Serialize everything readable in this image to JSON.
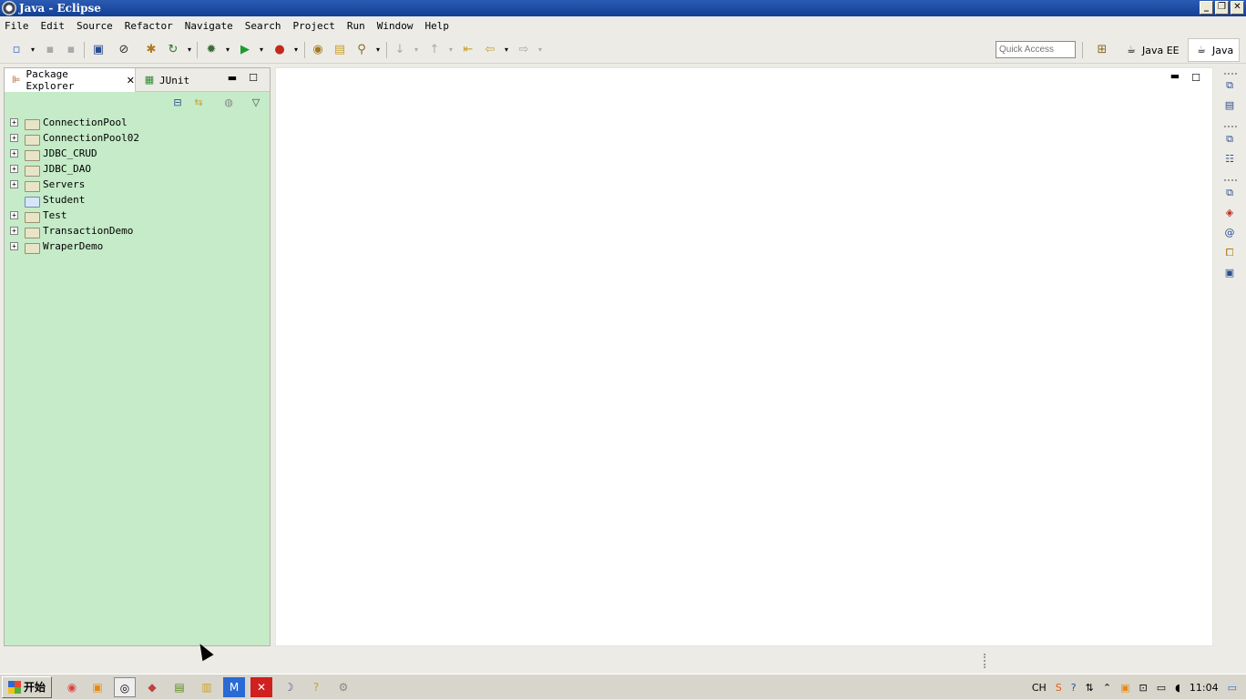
{
  "window": {
    "title": "Java - Eclipse",
    "controls": [
      "_",
      "❐",
      "✕"
    ]
  },
  "menu": [
    "File",
    "Edit",
    "Source",
    "Refactor",
    "Navigate",
    "Search",
    "Project",
    "Run",
    "Window",
    "Help"
  ],
  "quick_access": {
    "placeholder": "Quick Access"
  },
  "perspectives": [
    {
      "label": "Java EE",
      "icon": "java-ee-perspective-icon"
    },
    {
      "label": "Java",
      "icon": "java-perspective-icon",
      "active": true
    }
  ],
  "left_view": {
    "tabs": [
      {
        "label": "Package Explorer",
        "active": true
      },
      {
        "label": "JUnit",
        "active": false
      }
    ],
    "tree": [
      {
        "label": "ConnectionPool",
        "expander": "+",
        "type": "project"
      },
      {
        "label": "ConnectionPool02",
        "expander": "+",
        "type": "project"
      },
      {
        "label": "JDBC_CRUD",
        "expander": "+",
        "type": "project"
      },
      {
        "label": "JDBC_DAO",
        "expander": "+",
        "type": "project"
      },
      {
        "label": "Servers",
        "expander": "+",
        "type": "folder"
      },
      {
        "label": "Student",
        "expander": "",
        "type": "closed-project"
      },
      {
        "label": "Test",
        "expander": "+",
        "type": "project"
      },
      {
        "label": "TransactionDemo",
        "expander": "+",
        "type": "project"
      },
      {
        "label": "WraperDemo",
        "expander": "+",
        "type": "project"
      }
    ]
  },
  "taskbar": {
    "start_label": "开始",
    "tray": {
      "lang": "CH",
      "clock": "11:04"
    }
  },
  "colors": {
    "package_explorer_bg": "#c5ebc8",
    "titlebar": "#1d4aa0"
  }
}
